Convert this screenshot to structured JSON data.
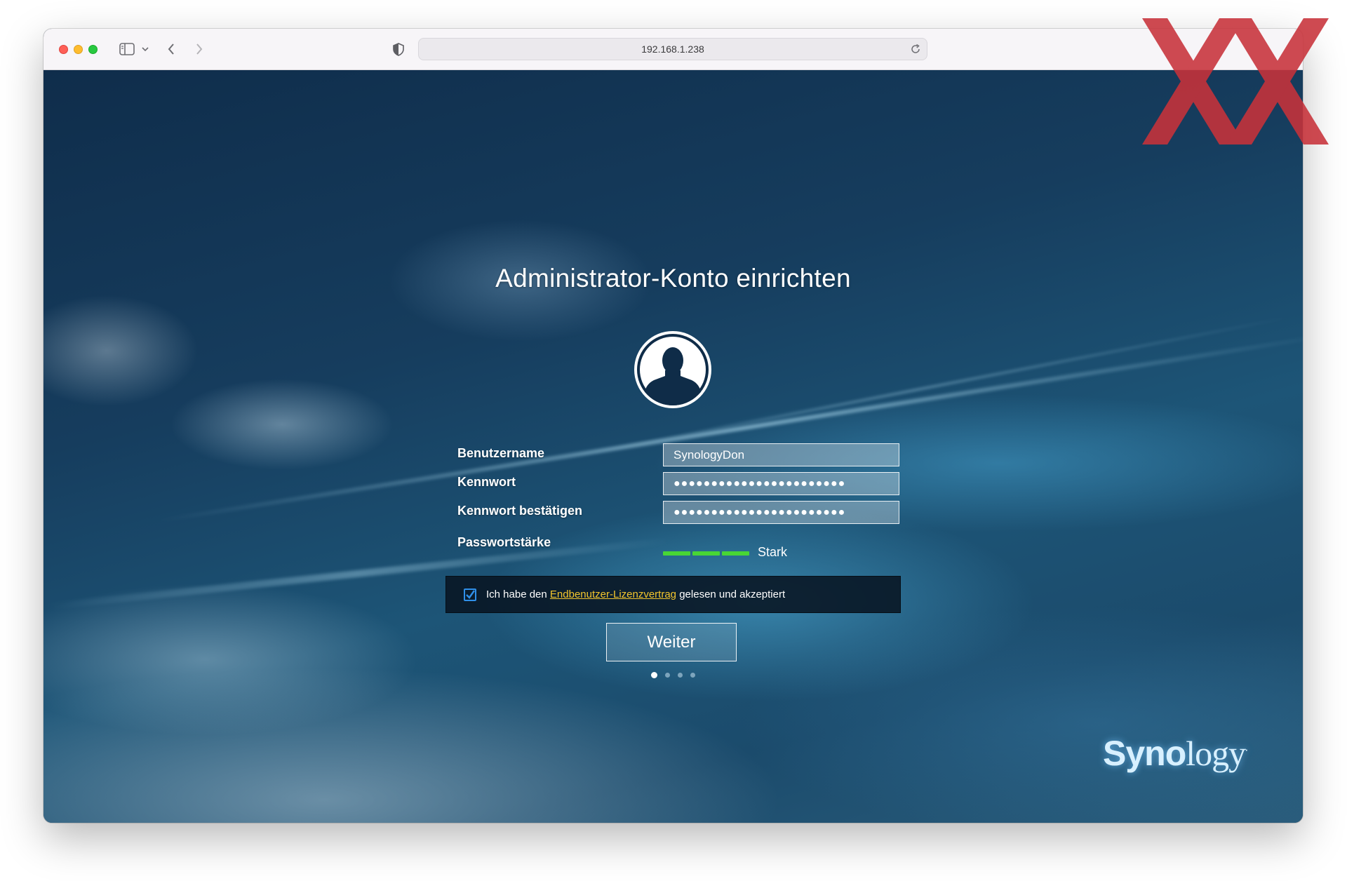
{
  "browser": {
    "url": "192.168.1.238"
  },
  "setup": {
    "title": "Administrator-Konto einrichten",
    "labels": {
      "username": "Benutzername",
      "password": "Kennwort",
      "confirm": "Kennwort bestätigen",
      "strength": "Passwortstärke"
    },
    "values": {
      "username": "SynologyDon",
      "password": "●●●●●●●●●●●●●●●●●●●●●●●",
      "confirm": "●●●●●●●●●●●●●●●●●●●●●●●"
    },
    "strength": {
      "text": "Stark",
      "level": 3,
      "max": 3,
      "color": "#48d635"
    },
    "eula": {
      "checked": true,
      "prefix": "Ich habe den",
      "link": "Endbenutzer-Lizenzvertrag",
      "suffix": "gelesen und akzeptiert"
    },
    "next_label": "Weiter",
    "steps": {
      "total": 4,
      "current": 1
    }
  },
  "brand": {
    "logo_bold": "Syno",
    "logo_thin": "logy"
  },
  "colors": {
    "accent_link": "#f3c52d",
    "checkbox": "#2f8fe8",
    "watermark": "#c8323a"
  }
}
